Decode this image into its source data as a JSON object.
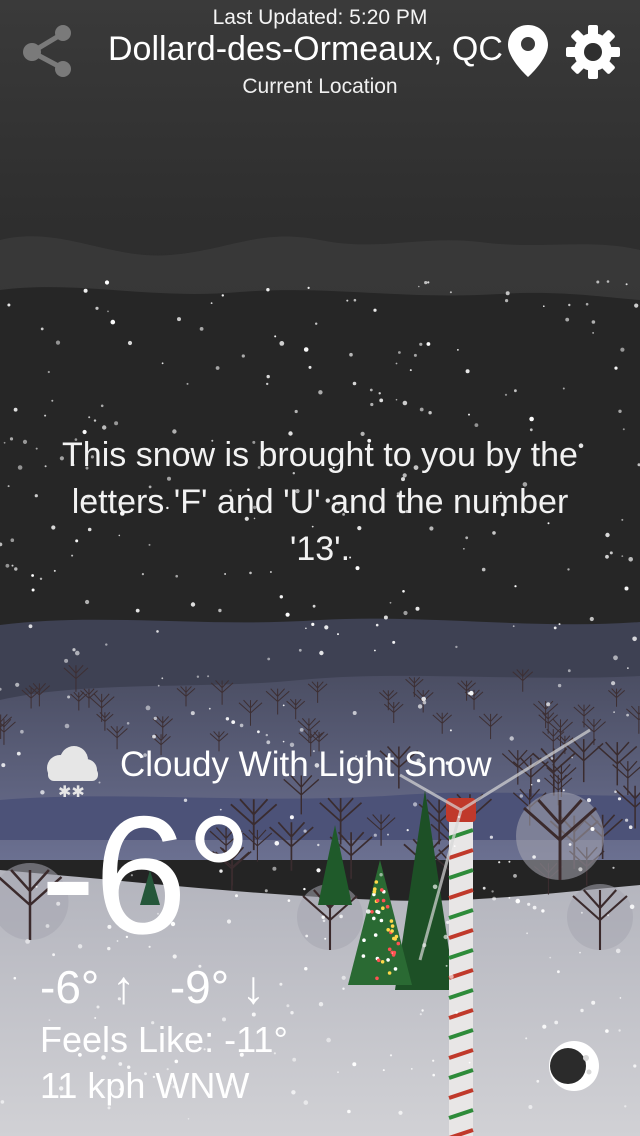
{
  "header": {
    "last_updated": "Last Updated: 5:20 PM",
    "city": "Dollard-des-Ormeaux, QC",
    "location_label": "Current Location",
    "icons": [
      "share-icon",
      "location-pin-icon",
      "gear-icon"
    ]
  },
  "message": "This snow is brought to you by the letters 'F' and 'U' and the number '13'.",
  "weather": {
    "condition_icon": "cloud-snow-icon",
    "condition": "Cloudy With Light Snow",
    "temperature": "-6°",
    "high": "-6° ↑",
    "low": "-9° ↓",
    "feels_like": "Feels Like: -11°",
    "wind": "11 kph WNW"
  },
  "footer": {
    "moon_icon": "moon-phase-icon"
  },
  "colors": {
    "sky_top": "#2b2b2b",
    "hills_far": "#3b3b3b",
    "hills_mid": "#4b4f66",
    "field": "#6d728f",
    "snow_ground": "#c9c9cd",
    "tree_green": "#1f5a2a",
    "pole_red": "#c0392b"
  }
}
